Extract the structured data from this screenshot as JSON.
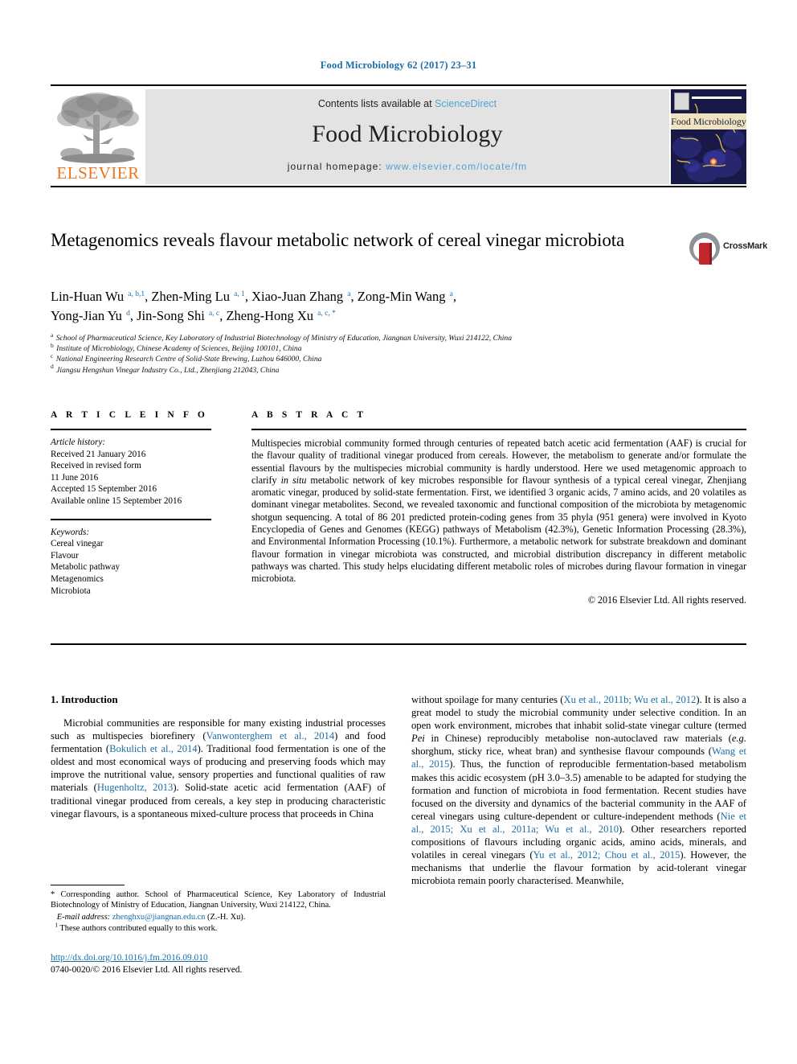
{
  "running_head": "Food Microbiology 62 (2017) 23–31",
  "masthead": {
    "contents_prefix": "Contents lists available at ",
    "contents_link": "ScienceDirect",
    "journal_name": "Food Microbiology",
    "homepage_prefix": "journal homepage: ",
    "homepage_url": "www.elsevier.com/locate/fm",
    "publisher_wordmark": "ELSEVIER",
    "cover_title": "Food Microbiology"
  },
  "article": {
    "title": "Metagenomics reveals flavour metabolic network of cereal vinegar microbiota",
    "crossmark_label": "CrossMark",
    "authors_line_1": "Lin-Huan Wu <sup>a, b,1</sup>, Zhen-Ming Lu <sup>a, 1</sup>, Xiao-Juan Zhang <sup>a</sup>, Zong-Min Wang <sup>a</sup>,",
    "authors_line_2": "Yong-Jian Yu <sup>d</sup>, Jin-Song Shi <sup>a, c</sup>, Zheng-Hong Xu <sup>a, c, *</sup>",
    "affiliations": [
      "<sup>a</sup> School of Pharmaceutical Science, Key Laboratory of Industrial Biotechnology of Ministry of Education, Jiangnan University, Wuxi 214122, China",
      "<sup>b</sup> Institute of Microbiology, Chinese Academy of Sciences, Beijing 100101, China",
      "<sup>c</sup> National Engineering Research Centre of Solid-State Brewing, Luzhou 646000, China",
      "<sup>d</sup> Jiangsu Hengshun Vinegar Industry Co., Ltd., Zhenjiang 212043, China"
    ]
  },
  "article_info": {
    "heading": "A R T I C L E  I N F O",
    "history_label": "Article history:",
    "history_lines": [
      "Received 21 January 2016",
      "Received in revised form",
      "11 June 2016",
      "Accepted 15 September 2016",
      "Available online 15 September 2016"
    ],
    "keywords_label": "Keywords:",
    "keywords": [
      "Cereal vinegar",
      "Flavour",
      "Metabolic pathway",
      "Metagenomics",
      "Microbiota"
    ]
  },
  "abstract": {
    "heading": "A B S T R A C T",
    "text": "Multispecies microbial community formed through centuries of repeated batch acetic acid fermentation (AAF) is crucial for the flavour quality of traditional vinegar produced from cereals. However, the metabolism to generate and/or formulate the essential flavours by the multispecies microbial community is hardly understood. Here we used metagenomic approach to clarify <i>in situ</i> metabolic network of key microbes responsible for flavour synthesis of a typical cereal vinegar, Zhenjiang aromatic vinegar, produced by solid-state fermentation. First, we identified 3 organic acids, 7 amino acids, and 20 volatiles as dominant vinegar metabolites. Second, we revealed taxonomic and functional composition of the microbiota by metagenomic shotgun sequencing. A total of 86 201 predicted protein-coding genes from 35 phyla (951 genera) were involved in Kyoto Encyclopedia of Genes and Genomes (KEGG) pathways of Metabolism (42.3%), Genetic Information Processing (28.3%), and Environmental Information Processing (10.1%). Furthermore, a metabolic network for substrate breakdown and dominant flavour formation in vinegar microbiota was constructed, and microbial distribution discrepancy in different metabolic pathways was charted. This study helps elucidating different metabolic roles of microbes during flavour formation in vinegar microbiota.",
    "copyright": "© 2016 Elsevier Ltd. All rights reserved."
  },
  "body": {
    "section_number_title": "1. Introduction",
    "left_paragraph": "Microbial communities are responsible for many existing industrial processes such as multispecies biorefinery (<span class=\"ref\">Vanwonterghem et al., 2014</span>) and food fermentation (<span class=\"ref\">Bokulich et al., 2014</span>). Traditional food fermentation is one of the oldest and most economical ways of producing and preserving foods which may improve the nutritional value, sensory properties and functional qualities of raw materials (<span class=\"ref\">Hugenholtz, 2013</span>). Solid-state acetic acid fermentation (AAF) of traditional vinegar produced from cereals, a key step in producing characteristic vinegar flavours, is a spontaneous mixed-culture process that proceeds in China",
    "right_paragraph": "without spoilage for many centuries (<span class=\"ref\">Xu et al., 2011b; Wu et al., 2012</span>). It is also a great model to study the microbial community under selective condition. In an open work environment, microbes that inhabit solid-state vinegar culture (termed <i>Pei</i> in Chinese) reproducibly metabolise non-autoclaved raw materials (<i>e.g.</i> shorghum, sticky rice, wheat bran) and synthesise flavour compounds (<span class=\"ref\">Wang et al., 2015</span>). Thus, the function of reproducible fermentation-based metabolism makes this acidic ecosystem (pH 3.0–3.5) amenable to be adapted for studying the formation and function of microbiota in food fermentation. Recent studies have focused on the diversity and dynamics of the bacterial community in the AAF of cereal vinegars using culture-dependent or culture-independent methods (<span class=\"ref\">Nie et al., 2015; Xu et al., 2011a; Wu et al., 2010</span>). Other researchers reported compositions of flavours including organic acids, amino acids, minerals, and volatiles in cereal vinegars (<span class=\"ref\">Yu et al., 2012; Chou et al., 2015</span>). However, the mechanisms that underlie the flavour formation by acid-tolerant vinegar microbiota remain poorly characterised. Meanwhile,"
  },
  "footnotes": {
    "corresponding": "<span class=\"star\">*</span> Corresponding author. School of Pharmaceutical Science, Key Laboratory of Industrial Biotechnology of Ministry of Education, Jiangnan University, Wuxi 214122, China.",
    "email_label": "E-mail address:",
    "email": "zhenghxu@jiangnan.edu.cn",
    "email_suffix": "(Z.-H. Xu).",
    "equal_contrib": "These authors contributed equally to this work.",
    "equal_contrib_marker": "1"
  },
  "doi_block": {
    "doi_url": "http://dx.doi.org/10.1016/j.fm.2016.09.010",
    "issn_line": "0740-0020/© 2016 Elsevier Ltd. All rights reserved."
  },
  "colors": {
    "link_blue": "#1a6ea8",
    "sciencedirect_blue": "#4ea3d9",
    "elsevier_orange": "#E87722",
    "masthead_gray": "#e3e3e3",
    "crossmark_red": "#c1272d"
  }
}
